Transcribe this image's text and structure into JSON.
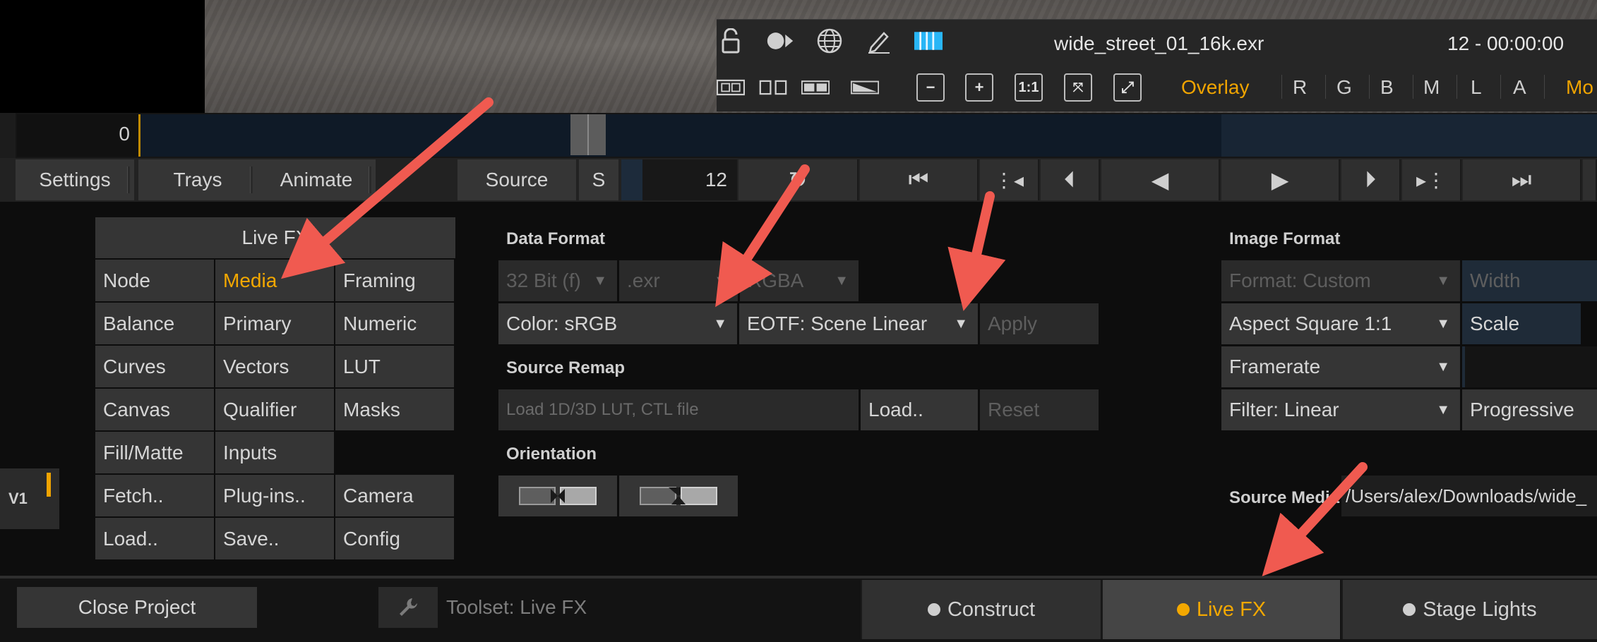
{
  "viewer": {
    "clip_name": "wide_street_01_16k.exr",
    "frame_time": "12  -  00:00:00",
    "overlay_label": "Overlay",
    "channels": [
      "R",
      "G",
      "B",
      "M",
      "L",
      "A"
    ],
    "mode_label_partial": "Mo",
    "zoom_one_to_one": "1:1",
    "icons": [
      "lock-open-icon",
      "record-icon",
      "globe-icon",
      "pen-icon",
      "color-bars-icon",
      "film-strip-icon",
      "film-dual-icon",
      "split-view-icon",
      "gradient-icon",
      "zoom-out-icon",
      "zoom-in-icon",
      "zoom-1to1-icon",
      "fit-icon",
      "fullscreen-icon"
    ]
  },
  "timeline": {
    "start_frame": "0"
  },
  "controls": {
    "settings": "Settings",
    "trays": "Trays",
    "animate": "Animate",
    "source": "Source",
    "s": "S",
    "current_frame": "12"
  },
  "livefx": {
    "header": "Live FX",
    "cells": [
      [
        "Node",
        "Media",
        "Framing"
      ],
      [
        "Balance",
        "Primary",
        "Numeric"
      ],
      [
        "Curves",
        "Vectors",
        "LUT"
      ],
      [
        "Canvas",
        "Qualifier",
        "Masks"
      ],
      [
        "Fill/Matte",
        "Inputs",
        ""
      ],
      [
        "Fetch..",
        "Plug-ins..",
        "Camera"
      ],
      [
        "Load..",
        "Save..",
        "Config"
      ]
    ]
  },
  "data_format": {
    "label": "Data Format",
    "bit_depth": "32 Bit (f)",
    "extension": ".exr",
    "channels": "RGBA",
    "color": "Color: sRGB",
    "eotf": "EOTF: Scene Linear",
    "apply": "Apply"
  },
  "source_remap": {
    "label": "Source Remap",
    "lut_placeholder": "Load 1D/3D LUT, CTL file",
    "load": "Load..",
    "reset": "Reset"
  },
  "orientation": {
    "label": "Orientation"
  },
  "image_format": {
    "label": "Image Format",
    "format": "Format: Custom",
    "width": "Width",
    "aspect": "Aspect Square 1:1",
    "scale": "Scale",
    "framerate": "Framerate",
    "filter": "Filter: Linear",
    "scan": "Progressive"
  },
  "source_media": {
    "label": "Source Media",
    "path": "/Users/alex/Downloads/wide_"
  },
  "side": {
    "v1": "V1"
  },
  "bottom": {
    "close_project": "Close Project",
    "toolset": "Toolset: Live FX",
    "tabs": [
      "Construct",
      "Live FX",
      "Stage Lights"
    ]
  },
  "colors": {
    "accent": "#f3a800",
    "arrow": "#f05a50"
  }
}
